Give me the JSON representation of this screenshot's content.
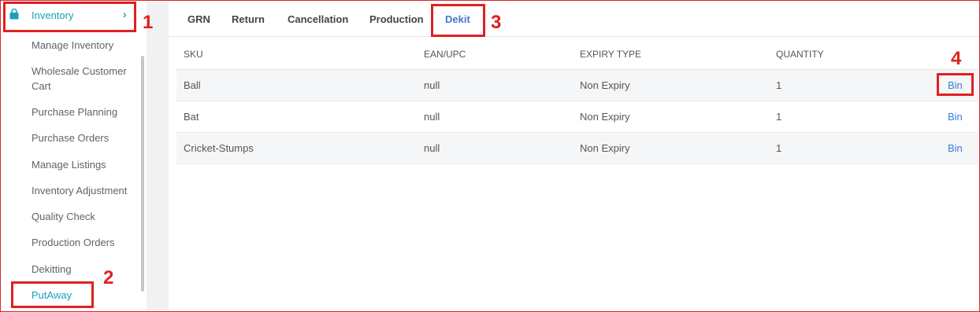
{
  "sidebar": {
    "inventory_label": "Inventory",
    "items": [
      {
        "label": "Manage Inventory"
      },
      {
        "label": "Wholesale Customer Cart"
      },
      {
        "label": "Purchase Planning"
      },
      {
        "label": "Purchase Orders"
      },
      {
        "label": "Manage Listings"
      },
      {
        "label": "Inventory Adjustment"
      },
      {
        "label": "Quality Check"
      },
      {
        "label": "Production Orders"
      },
      {
        "label": "Dekitting"
      },
      {
        "label": "PutAway"
      }
    ]
  },
  "tabs": [
    {
      "label": "GRN"
    },
    {
      "label": "Return"
    },
    {
      "label": "Cancellation"
    },
    {
      "label": "Production"
    },
    {
      "label": "Dekit"
    }
  ],
  "active_tab": "Dekit",
  "table": {
    "headers": [
      "SKU",
      "EAN/UPC",
      "EXPIRY TYPE",
      "QUANTITY"
    ],
    "rows": [
      {
        "sku": "Ball",
        "ean": "null",
        "expiry": "Non Expiry",
        "qty": "1",
        "action": "Bin"
      },
      {
        "sku": "Bat",
        "ean": "null",
        "expiry": "Non Expiry",
        "qty": "1",
        "action": "Bin"
      },
      {
        "sku": "Cricket-Stumps",
        "ean": "null",
        "expiry": "Non Expiry",
        "qty": "1",
        "action": "Bin"
      }
    ]
  },
  "annotations": [
    "1",
    "2",
    "3",
    "4"
  ],
  "colors": {
    "accent": "#17a2b8",
    "tab_active": "#4a76c9",
    "link": "#3a7bd5",
    "annotation": "#e02020"
  },
  "icons": {
    "inventory": "shopping-bag-icon",
    "chevron": "chevron-right-icon"
  }
}
